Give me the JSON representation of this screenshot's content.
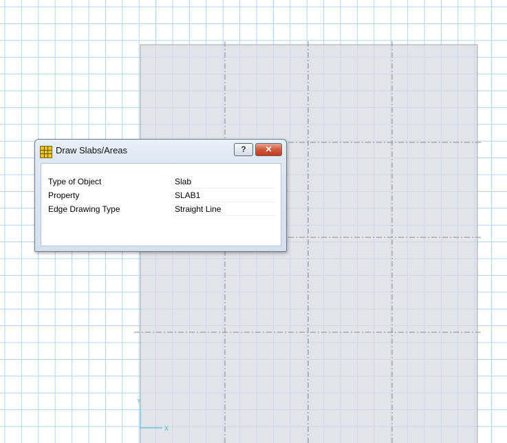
{
  "dialog": {
    "title": "Draw Slabs/Areas",
    "help_label": "?",
    "close_label": "✕",
    "rows": [
      {
        "label": "Type of Object",
        "value": "Slab"
      },
      {
        "label": "Property",
        "value": "SLAB1"
      },
      {
        "label": "Edge Drawing Type",
        "value": "Straight Line"
      }
    ]
  },
  "axis": {
    "y_label": "Y",
    "x_label": "X"
  },
  "colors": {
    "grid": "#b3d3ef",
    "slab_fill": "#d8dbe2",
    "dialog_border": "#6f7f93",
    "close_red": "#c13b1e",
    "axis_tick": "#34b8d8"
  },
  "icons": {
    "app": "etabs-app-icon",
    "help": "help-icon",
    "close": "close-icon"
  }
}
